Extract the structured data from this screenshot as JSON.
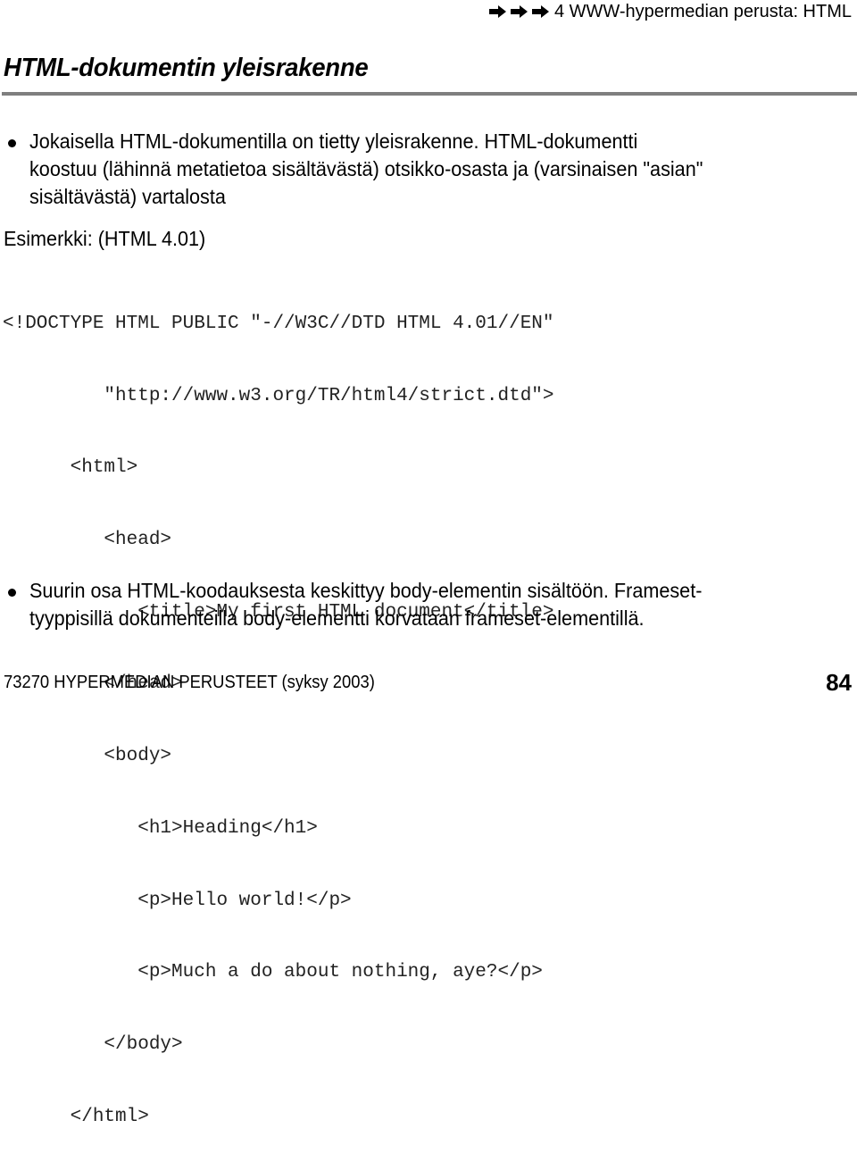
{
  "header": {
    "nav_icons": [
      "arrow-right-icon",
      "arrow-right-icon",
      "arrow-right-icon"
    ],
    "chapter": "4 WWW-hypermedian perusta: HTML"
  },
  "title": "HTML-dokumentin yleisrakenne",
  "bullets": [
    {
      "lines": [
        "Jokaisella HTML-dokumentilla on tietty yleisrakenne. HTML-dokumentti",
        "koostuu (lähinnä metatietoa sisältävästä) otsikko-osasta ja (varsinaisen \"asian\"",
        "sisältävästä) vartalosta"
      ]
    },
    {
      "lines": [
        "Suurin osa HTML-koodauksesta keskittyy body-elementin sisältöön. Frameset-",
        "tyyppisillä dokumenteilla body-elementti korvataan frameset-elementillä."
      ]
    }
  ],
  "example_label": "Esimerkki: (HTML 4.01)",
  "code_lines": [
    "<!DOCTYPE HTML PUBLIC \"-//W3C//DTD HTML 4.01//EN\"",
    "         \"http://www.w3.org/TR/html4/strict.dtd\">",
    "      <html>",
    "         <head>",
    "            <title>My first HTML document</title>",
    "         </head>",
    "         <body>",
    "            <h1>Heading</h1>",
    "            <p>Hello world!</p>",
    "            <p>Much a do about nothing, aye?</p>",
    "         </body>",
    "      </html>"
  ],
  "footer": {
    "course": "73270 HYPERMEDIAN PERUSTEET (syksy 2003)",
    "page_number": "84"
  }
}
